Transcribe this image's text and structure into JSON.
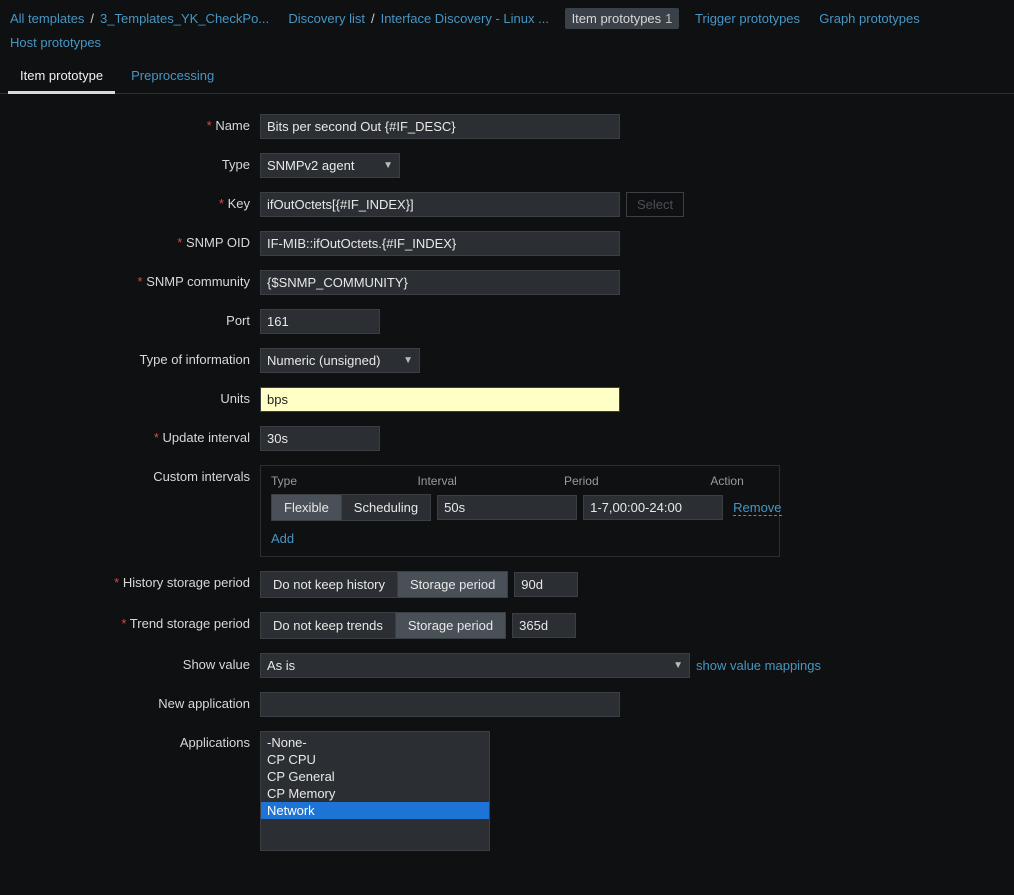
{
  "breadcrumb": {
    "all_templates": "All templates",
    "template_name": "3_Templates_YK_CheckPo...",
    "discovery_list": "Discovery list",
    "discovery_rule": "Interface Discovery - Linux ...",
    "item_prototypes_label": "Item prototypes",
    "item_prototypes_count": "1",
    "trigger_prototypes": "Trigger prototypes",
    "graph_prototypes": "Graph prototypes",
    "host_prototypes": "Host prototypes"
  },
  "tabs": {
    "item_prototype": "Item prototype",
    "preprocessing": "Preprocessing"
  },
  "labels": {
    "name": "Name",
    "type": "Type",
    "key": "Key",
    "snmp_oid": "SNMP OID",
    "snmp_community": "SNMP community",
    "port": "Port",
    "type_of_information": "Type of information",
    "units": "Units",
    "update_interval": "Update interval",
    "custom_intervals": "Custom intervals",
    "history_storage": "History storage period",
    "trend_storage": "Trend storage period",
    "show_value": "Show value",
    "new_application": "New application",
    "applications": "Applications"
  },
  "values": {
    "name": "Bits per second Out {#IF_DESC}",
    "type": "SNMPv2 agent",
    "key": "ifOutOctets[{#IF_INDEX}]",
    "snmp_oid": "IF-MIB::ifOutOctets.{#IF_INDEX}",
    "snmp_community": "{$SNMP_COMMUNITY}",
    "port": "161",
    "type_of_information": "Numeric (unsigned)",
    "units": "bps",
    "update_interval": "30s",
    "history_period": "90d",
    "trend_period": "365d",
    "show_value": "As is",
    "new_application": ""
  },
  "buttons": {
    "select": "Select",
    "do_not_keep_history": "Do not keep history",
    "storage_period": "Storage period",
    "do_not_keep_trends": "Do not keep trends",
    "show_value_mappings": "show value mappings"
  },
  "intervals": {
    "head_type": "Type",
    "head_interval": "Interval",
    "head_period": "Period",
    "head_action": "Action",
    "flexible": "Flexible",
    "scheduling": "Scheduling",
    "row_interval": "50s",
    "row_period": "1-7,00:00-24:00",
    "remove": "Remove",
    "add": "Add"
  },
  "applications": {
    "options": [
      "-None-",
      "CP CPU",
      "CP General",
      "CP Memory",
      "Network"
    ],
    "selected": "Network"
  }
}
